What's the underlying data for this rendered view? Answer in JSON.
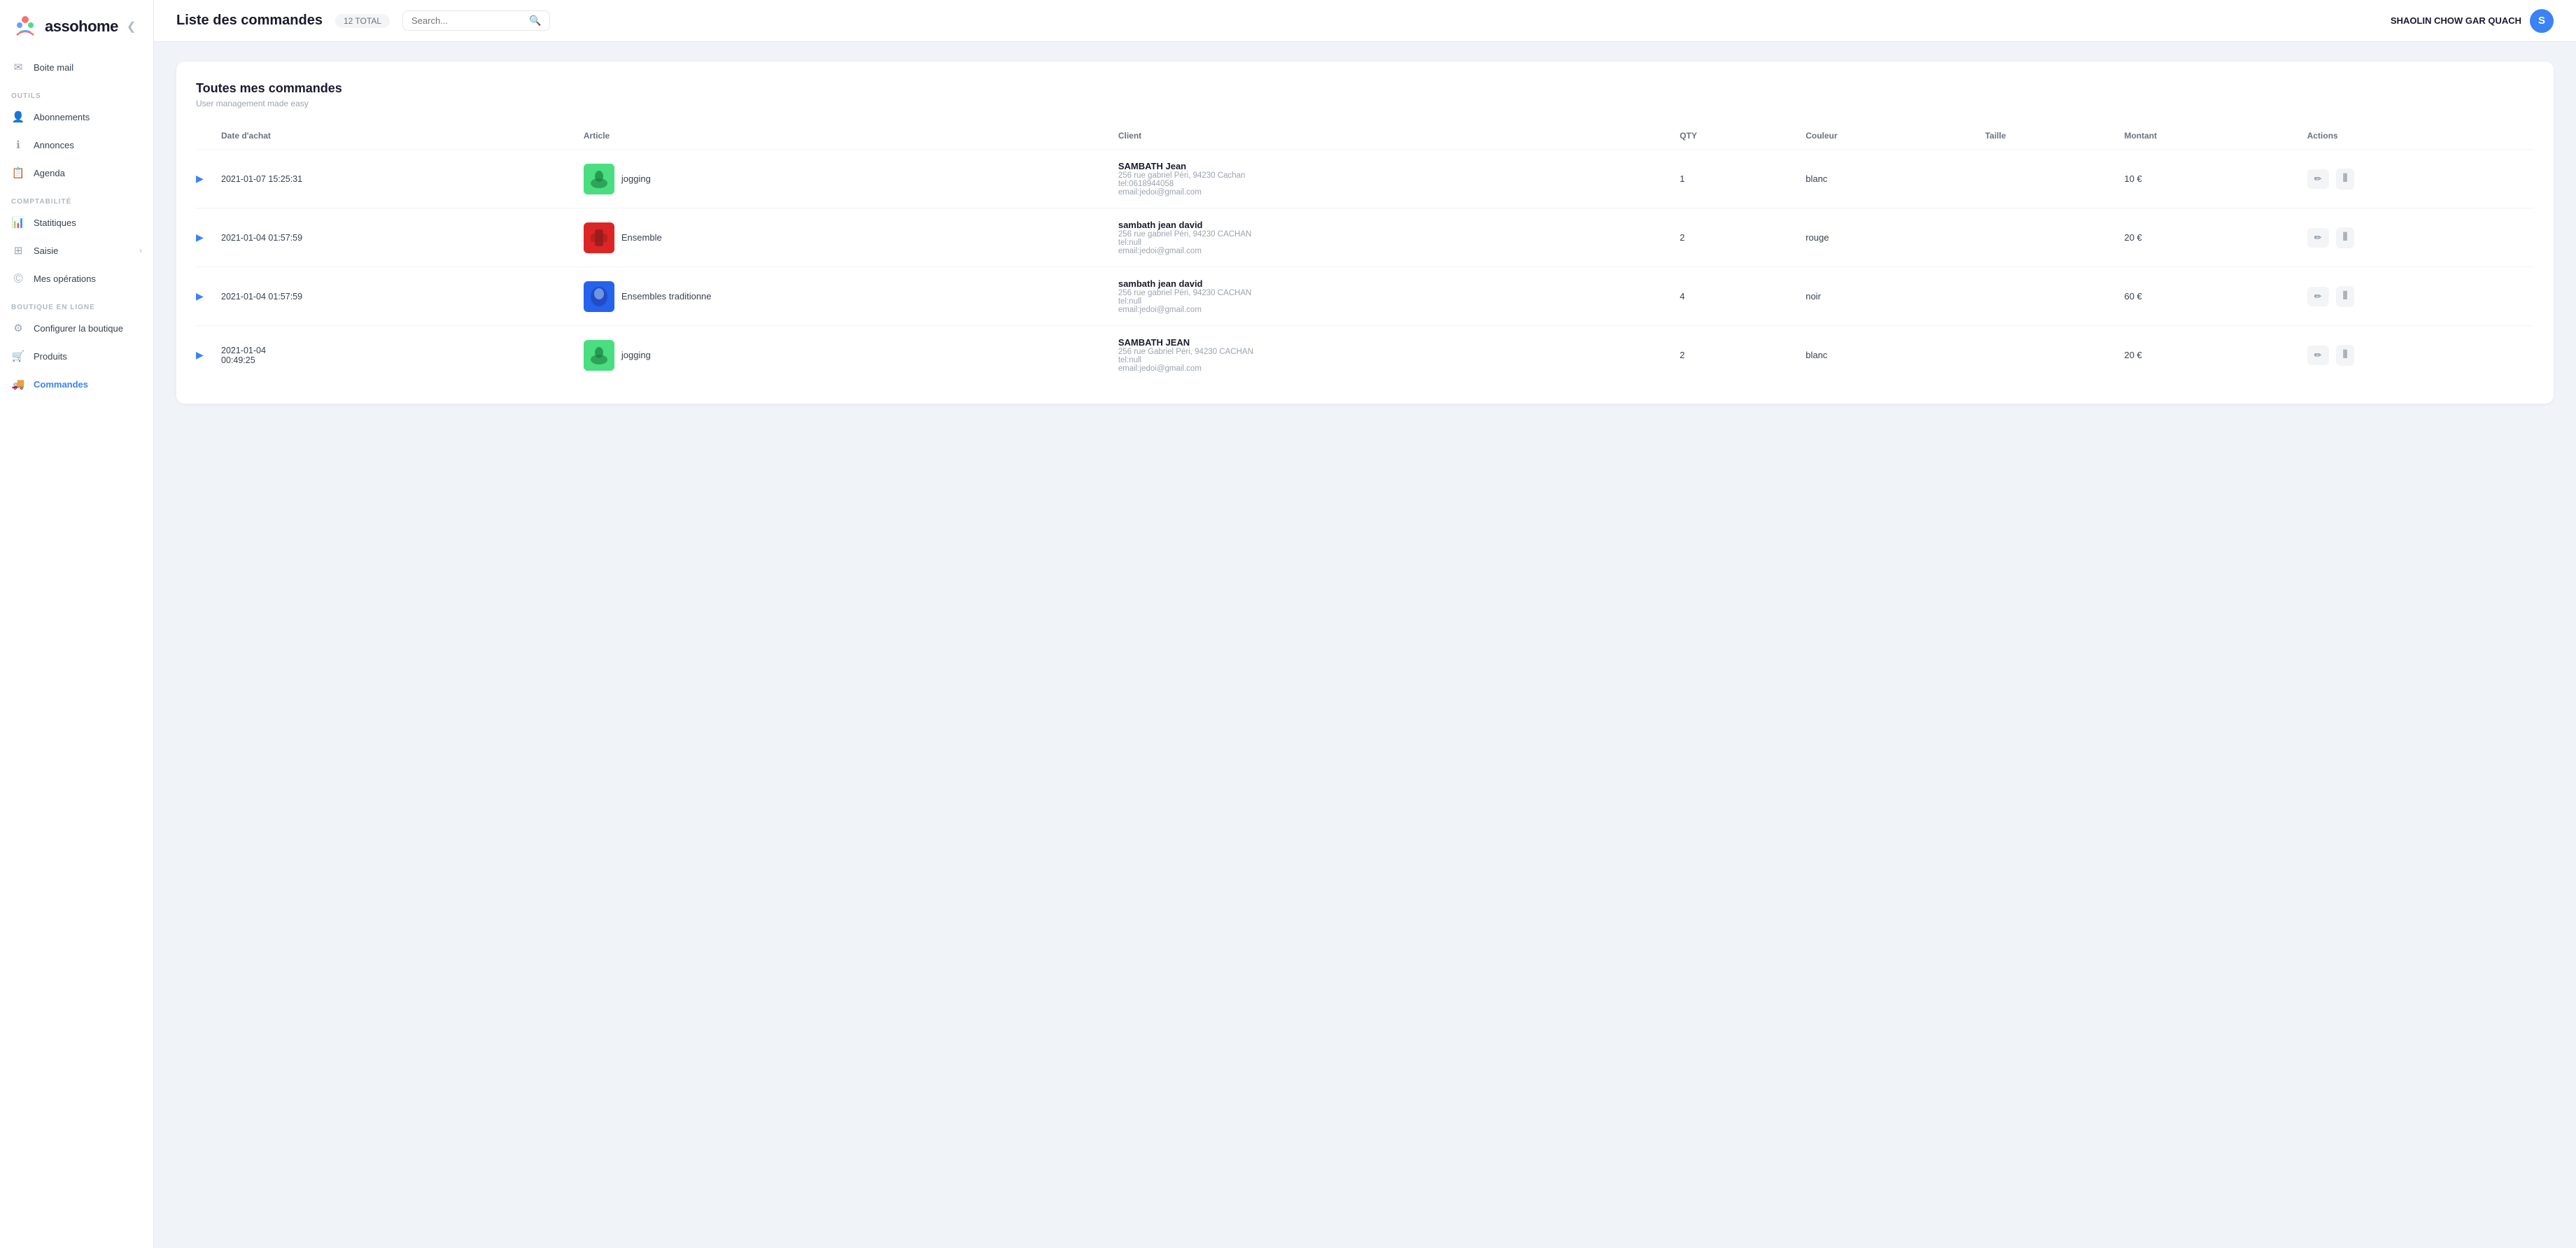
{
  "app": {
    "logo_text": "assohome",
    "collapse_icon": "❮"
  },
  "topbar": {
    "title": "Liste des commandes",
    "total_label": "12 TOTAL",
    "search_placeholder": "Search...",
    "user_name": "SHAOLIN CHOW GAR QUACH",
    "user_initial": "S"
  },
  "sidebar": {
    "boite_mail": "Boite mail",
    "sections": [
      {
        "label": "OUTILS",
        "items": [
          {
            "id": "abonnements",
            "label": "Abonnements",
            "icon": "person"
          },
          {
            "id": "annonces",
            "label": "Annonces",
            "icon": "info"
          },
          {
            "id": "agenda",
            "label": "Agenda",
            "icon": "calendar"
          }
        ]
      },
      {
        "label": "COMPTABILITÉ",
        "items": [
          {
            "id": "statistiques",
            "label": "Statitiques",
            "icon": "chart"
          },
          {
            "id": "saisie",
            "label": "Saisie",
            "icon": "grid",
            "has_chevron": true
          },
          {
            "id": "mes-operations",
            "label": "Mes opérations",
            "icon": "circle"
          }
        ]
      },
      {
        "label": "BOUTIQUE EN LIGNE",
        "items": [
          {
            "id": "configurer-boutique",
            "label": "Configurer la boutique",
            "icon": "gear"
          },
          {
            "id": "produits",
            "label": "Produits",
            "icon": "cart"
          },
          {
            "id": "commandes",
            "label": "Commandes",
            "icon": "truck",
            "active": true
          }
        ]
      }
    ]
  },
  "card": {
    "title": "Toutes mes commandes",
    "subtitle": "User management made easy"
  },
  "table": {
    "columns": [
      "",
      "Date d'achat",
      "Article",
      "Client",
      "QTY",
      "Couleur",
      "Taille",
      "Montant",
      "Actions"
    ],
    "rows": [
      {
        "id": "row-1",
        "date": "2021-01-07 15:25:31",
        "article_name": "jogging",
        "article_thumb_class": "thumb-green",
        "client_name": "SAMBATH Jean",
        "client_addr": "256 rue gabriel Péri, 94230 Cachan",
        "client_phone": "tel:0618944058",
        "client_email": "email:jedoi@gmail.com",
        "qty": "1",
        "color": "blanc",
        "size": "",
        "amount": "10 €"
      },
      {
        "id": "row-2",
        "date": "2021-01-04 01:57:59",
        "article_name": "Ensemble",
        "article_thumb_class": "thumb-red",
        "client_name": "sambath jean david",
        "client_addr": "256 rue gabriel Péri, 94230 CACHAN",
        "client_phone": "tel:null",
        "client_email": "email:jedoi@gmail.com",
        "qty": "2",
        "color": "rouge",
        "size": "",
        "amount": "20 €"
      },
      {
        "id": "row-3",
        "date": "2021-01-04 01:57:59",
        "article_name": "Ensembles traditionne",
        "article_thumb_class": "thumb-blue",
        "client_name": "sambath jean david",
        "client_addr": "256 rue gabriel Péri, 94230 CACHAN",
        "client_phone": "tel:null",
        "client_email": "email:jedoi@gmail.com",
        "qty": "4",
        "color": "noir",
        "size": "",
        "amount": "60 €"
      },
      {
        "id": "row-4",
        "date": "2021-01-04 00:49:25",
        "article_name": "jogging",
        "article_thumb_class": "thumb-green",
        "client_name": "SAMBATH JEAN",
        "client_addr": "256 rue Gabriel Péri, 94230 CACHAN",
        "client_phone": "tel:null",
        "client_email": "email:jedoi@gmail.com",
        "qty": "2",
        "color": "blanc",
        "size": "",
        "amount": "20 €"
      }
    ]
  }
}
